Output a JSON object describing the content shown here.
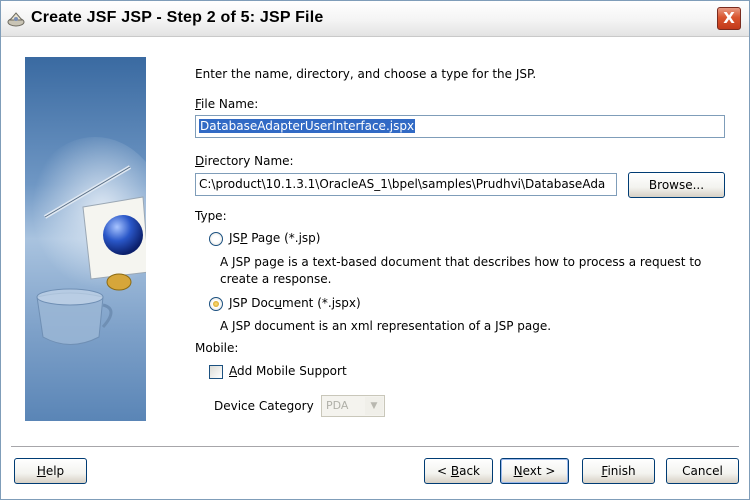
{
  "window": {
    "title": "Create JSF JSP - Step 2 of 5: JSP File",
    "close_glyph": "X"
  },
  "instructions": "Enter the name, directory, and choose a type for the JSP.",
  "file_name": {
    "label_mnemonic": "F",
    "label_rest": "ile Name:",
    "value": "DatabaseAdapterUserInterface.jspx"
  },
  "directory": {
    "label_mnemonic": "D",
    "label_rest": "irectory Name:",
    "value": "C:\\product\\10.1.3.1\\OracleAS_1\\bpel\\samples\\Prudhvi\\DatabaseAda",
    "browse_label": "Browse..."
  },
  "type": {
    "label": "Type:",
    "options": [
      {
        "label_pre": "JS",
        "label_mnemonic": "P",
        "label_post": " Page (*.jsp)",
        "description": "A JSP page is a text-based document that describes how to process a request to create a response.",
        "description_line1": "A JSP page is a text-based document that describes how to process a request to",
        "description_line2": "create a response.",
        "checked": false
      },
      {
        "label_pre": "JSP Doc",
        "label_mnemonic": "u",
        "label_post": "ment (*.jspx)",
        "description": "A JSP document is an xml representation of a JSP page.",
        "checked": true
      }
    ]
  },
  "mobile": {
    "label": "Mobile:",
    "add_support": {
      "label_mnemonic": "A",
      "label_rest": "dd Mobile Support",
      "checked": false
    },
    "device_category": {
      "label": "Device Category",
      "value": "PDA",
      "enabled": false
    }
  },
  "buttons": {
    "help": {
      "mnemonic": "H",
      "rest": "elp"
    },
    "back": {
      "prefix": "< ",
      "mnemonic": "B",
      "rest": "ack"
    },
    "next": {
      "mnemonic": "N",
      "rest": "ext >"
    },
    "finish": {
      "mnemonic": "F",
      "rest": "inish"
    },
    "cancel": {
      "label": "Cancel"
    }
  },
  "colors": {
    "selection": "#316ac5",
    "border": "#7f9db9",
    "close_button": "#d9552f"
  },
  "icons": {
    "title": "jdeveloper-wizard-icon",
    "side_image": "wizard-graphic-globe-document-cup"
  }
}
